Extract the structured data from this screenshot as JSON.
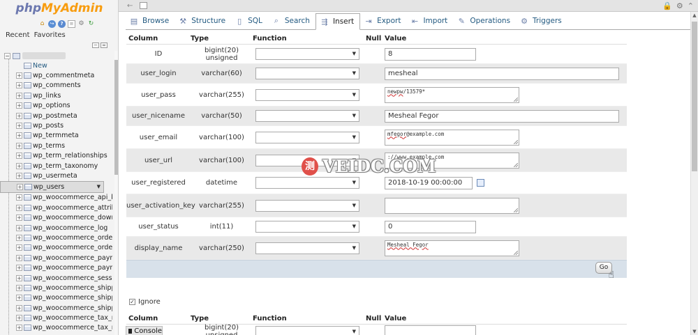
{
  "logo": {
    "php": "php",
    "myadmin": "MyAdmin"
  },
  "nav_tabs": {
    "recent": "Recent",
    "favorites": "Favorites"
  },
  "nav_icons": [
    "home-icon",
    "exit-icon",
    "help-icon",
    "docs-icon",
    "settings-icon",
    "reload-icon"
  ],
  "tree": {
    "new_label": "New",
    "tables": [
      "wp_commentmeta",
      "wp_comments",
      "wp_links",
      "wp_options",
      "wp_postmeta",
      "wp_posts",
      "wp_termmeta",
      "wp_terms",
      "wp_term_relationships",
      "wp_term_taxonomy",
      "wp_usermeta",
      "wp_users",
      "wp_woocommerce_api_ke",
      "wp_woocommerce_attribut",
      "wp_woocommerce_downlo",
      "wp_woocommerce_log",
      "wp_woocommerce_order_",
      "wp_woocommerce_order_",
      "wp_woocommerce_payme",
      "wp_woocommerce_payme",
      "wp_woocommerce_sessio",
      "wp_woocommerce_shippir",
      "wp_woocommerce_shippir",
      "wp_woocommerce_shippir",
      "wp_woocommerce_tax_rat",
      "wp_woocommerce_tax_rat"
    ],
    "selected": "wp_users"
  },
  "console_label": "Console",
  "tabs": [
    {
      "label": "Browse",
      "icon": "browse-icon",
      "glyph": "▤"
    },
    {
      "label": "Structure",
      "icon": "structure-icon",
      "glyph": "⚒"
    },
    {
      "label": "SQL",
      "icon": "sql-icon",
      "glyph": "▯"
    },
    {
      "label": "Search",
      "icon": "search-icon",
      "glyph": "⌕"
    },
    {
      "label": "Insert",
      "icon": "insert-icon",
      "glyph": "⇶",
      "active": true
    },
    {
      "label": "Export",
      "icon": "export-icon",
      "glyph": "⇥"
    },
    {
      "label": "Import",
      "icon": "import-icon",
      "glyph": "⇤"
    },
    {
      "label": "Operations",
      "icon": "operations-icon",
      "glyph": "✎"
    },
    {
      "label": "Triggers",
      "icon": "triggers-icon",
      "glyph": "⚙"
    }
  ],
  "columns": {
    "column": "Column",
    "type": "Type",
    "function": "Function",
    "null": "Null",
    "value": "Value"
  },
  "rows": [
    {
      "name": "ID",
      "type": "bigint(20) unsigned",
      "value": "8",
      "kind": "short"
    },
    {
      "name": "user_login",
      "type": "varchar(60)",
      "value": "mesheal",
      "kind": "long"
    },
    {
      "name": "user_pass",
      "type": "varchar(255)",
      "value_plain": "/13579*",
      "value_squig": "newpw",
      "kind": "ta"
    },
    {
      "name": "user_nicename",
      "type": "varchar(50)",
      "value": "Mesheal Fegor",
      "kind": "long"
    },
    {
      "name": "user_email",
      "type": "varchar(100)",
      "value_plain": "@example.com",
      "value_squig": "mfegor",
      "kind": "ta"
    },
    {
      "name": "user_url",
      "type": "varchar(100)",
      "value_plain": "://www.example.com",
      "value_squig": "",
      "kind": "ta"
    },
    {
      "name": "user_registered",
      "type": "datetime",
      "value": "2018-10-19 00:00:00",
      "kind": "date"
    },
    {
      "name": "user_activation_key",
      "type": "varchar(255)",
      "value_plain": "",
      "value_squig": "",
      "kind": "ta"
    },
    {
      "name": "user_status",
      "type": "int(11)",
      "value": "0",
      "kind": "short"
    },
    {
      "name": "display_name",
      "type": "varchar(250)",
      "value_plain": "",
      "value_squig": "Mesheal Fegor",
      "kind": "ta"
    }
  ],
  "go_label": "Go",
  "ignore_label": "Ignore",
  "row2": {
    "type": "bigint(20) unsigned"
  },
  "watermark": {
    "badge": "测",
    "text": "VEIDC.COM"
  }
}
